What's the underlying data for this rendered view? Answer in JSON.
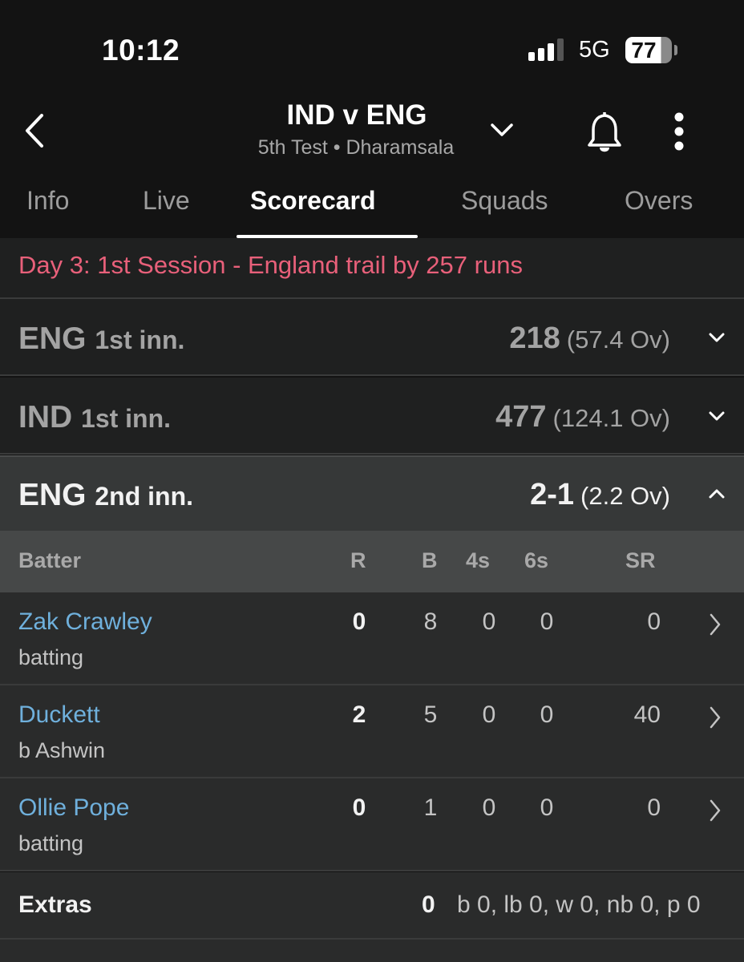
{
  "status_bar": {
    "time": "10:12",
    "network": "5G",
    "battery": "77",
    "signal_bars_active": 3,
    "signal_bars_total": 4
  },
  "header": {
    "title": "IND v ENG",
    "subtitle": "5th Test • Dharamsala",
    "icons": [
      "back-chevron",
      "dropdown-chevron",
      "bell",
      "more-vertical"
    ]
  },
  "tabs": [
    {
      "label": "Info",
      "active": false
    },
    {
      "label": "Live",
      "active": false
    },
    {
      "label": "Scorecard",
      "active": true
    },
    {
      "label": "Squads",
      "active": false
    },
    {
      "label": "Overs",
      "active": false
    }
  ],
  "match_status": "Day 3: 1st Session - England trail by 257 runs",
  "innings": [
    {
      "team": "ENG",
      "label": "1st inn.",
      "score": "218",
      "overs": "(57.4 Ov)",
      "expanded": false
    },
    {
      "team": "IND",
      "label": "1st inn.",
      "score": "477",
      "overs": "(124.1 Ov)",
      "expanded": false
    },
    {
      "team": "ENG",
      "label": "2nd inn.",
      "score": "2-1",
      "overs": "(2.2 Ov)",
      "expanded": true
    }
  ],
  "batting_table": {
    "columns": [
      "Batter",
      "R",
      "B",
      "4s",
      "6s",
      "SR"
    ],
    "rows": [
      {
        "name": "Zak Crawley",
        "dismissal": "batting",
        "R": "0",
        "B": "8",
        "4s": "0",
        "6s": "0",
        "SR": "0"
      },
      {
        "name": "Duckett",
        "dismissal": "b Ashwin",
        "R": "2",
        "B": "5",
        "4s": "0",
        "6s": "0",
        "SR": "40"
      },
      {
        "name": "Ollie Pope",
        "dismissal": "batting",
        "R": "0",
        "B": "1",
        "4s": "0",
        "6s": "0",
        "SR": "0"
      }
    ],
    "extras": {
      "label": "Extras",
      "total": "0",
      "detail": "b 0, lb 0, w 0, nb 0, p 0"
    }
  },
  "colors": {
    "status_text": "#e8607a",
    "batter_link": "#6fb0dc",
    "background": "#131313"
  }
}
